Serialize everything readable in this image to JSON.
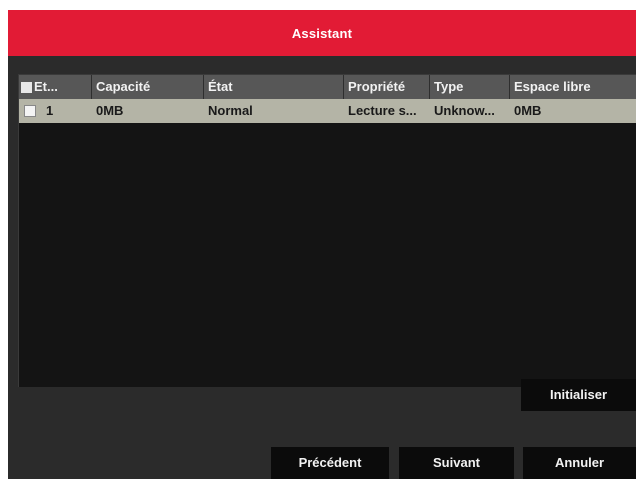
{
  "dialog": {
    "title": "Assistant"
  },
  "table": {
    "columns": [
      "Et...",
      "Capacité",
      "État",
      "Propriété",
      "Type",
      "Espace libre"
    ],
    "rows": [
      {
        "checked": false,
        "id": "1",
        "capacity": "0MB",
        "state": "Normal",
        "property": "Lecture s...",
        "type": "Unknow...",
        "free_space": "0MB"
      }
    ]
  },
  "buttons": {
    "initialize": "Initialiser",
    "previous": "Précédent",
    "next": "Suivant",
    "cancel": "Annuler"
  },
  "colors": {
    "titlebar": "#e21b35",
    "header": "#575757",
    "selected_row": "#b4b4a6",
    "background": "#2b2b2b"
  }
}
